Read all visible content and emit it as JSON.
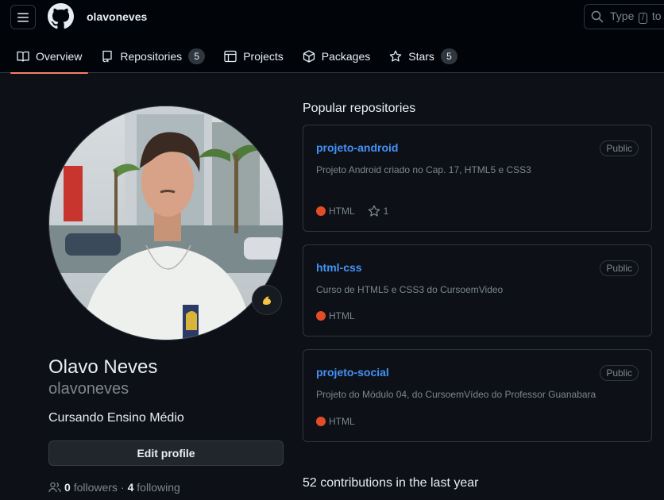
{
  "header": {
    "owner": "olavoneves",
    "search_text": "Type",
    "search_key": "/",
    "search_suffix": "to s"
  },
  "tabs": [
    {
      "label": "Overview",
      "icon": "book-icon",
      "counter": null,
      "active": true
    },
    {
      "label": "Repositories",
      "icon": "repo-icon",
      "counter": "5",
      "active": false
    },
    {
      "label": "Projects",
      "icon": "table-icon",
      "counter": null,
      "active": false
    },
    {
      "label": "Packages",
      "icon": "package-icon",
      "counter": null,
      "active": false
    },
    {
      "label": "Stars",
      "icon": "star-icon",
      "counter": "5",
      "active": false
    }
  ],
  "profile": {
    "name": "Olavo Neves",
    "login": "olavoneves",
    "bio": "Cursando Ensino Médio",
    "edit_label": "Edit profile",
    "status_emoji": "flexed-biceps",
    "followers_count": "0",
    "followers_label": "followers",
    "separator": "·",
    "following_count": "4",
    "following_label": "following"
  },
  "popular": {
    "title": "Popular repositories",
    "repos": [
      {
        "name": "projeto-android",
        "visibility": "Public",
        "description": "Projeto Android criado no Cap. 17, HTML5 e CSS3",
        "language": "HTML",
        "language_color": "#e34c26",
        "stars": "1"
      },
      {
        "name": "html-css",
        "visibility": "Public",
        "description": "Curso de HTML5 e CSS3 do CursoemVideo",
        "language": "HTML",
        "language_color": "#e34c26",
        "stars": null
      },
      {
        "name": "projeto-social",
        "visibility": "Public",
        "description": "Projeto do Módulo 04, do CursoemVídeo do Professor Guanabara",
        "language": "HTML",
        "language_color": "#e34c26",
        "stars": null
      }
    ]
  },
  "contributions": {
    "title": "52 contributions in the last year"
  },
  "colors": {
    "accent_tab": "#f78166",
    "link": "#4493f8",
    "background": "#0d1117",
    "header_bg": "#010409"
  }
}
